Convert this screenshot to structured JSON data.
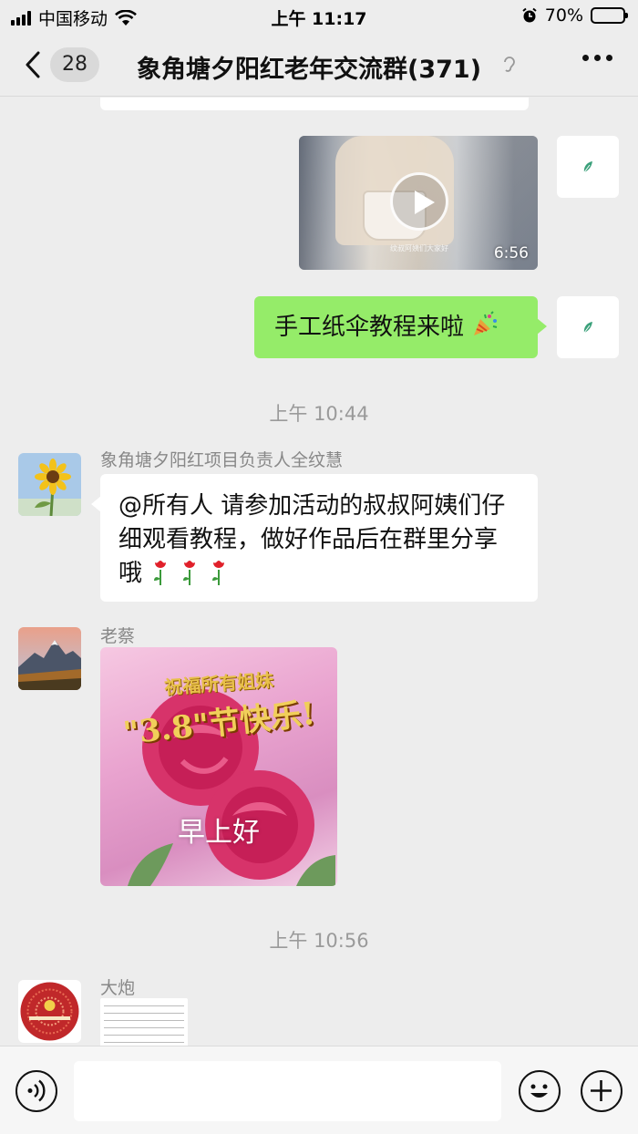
{
  "status_bar": {
    "carrier": "中国移动",
    "time": "上午 11:17",
    "battery": "70%",
    "battery_level": 0.7
  },
  "nav": {
    "unread_count": "28",
    "title": "象角塘夕阳红老年交流群(371)"
  },
  "messages": {
    "video": {
      "duration": "6:56",
      "caption": "纹叔阿姨们大家好"
    },
    "self_text": "手工纸伞教程来啦",
    "time_1": "上午 10:44",
    "msg1_sender": "象角塘夕阳红项目负责人全纹慧",
    "msg1_text": "@所有人 请参加活动的叔叔阿姨们仔细观看教程，做好作品后在群里分享哦",
    "msg2_sender": "老蔡",
    "image_text_top": "祝福所有姐妹",
    "image_text_mid": "\"3.8\"节快乐!",
    "image_text_bottom": "早上好",
    "time_2": "上午 10:56",
    "msg3_sender": "大炮"
  },
  "input": {
    "placeholder": ""
  },
  "colors": {
    "background": "#ededed",
    "self_bubble": "#95ec69",
    "other_bubble": "#ffffff"
  }
}
